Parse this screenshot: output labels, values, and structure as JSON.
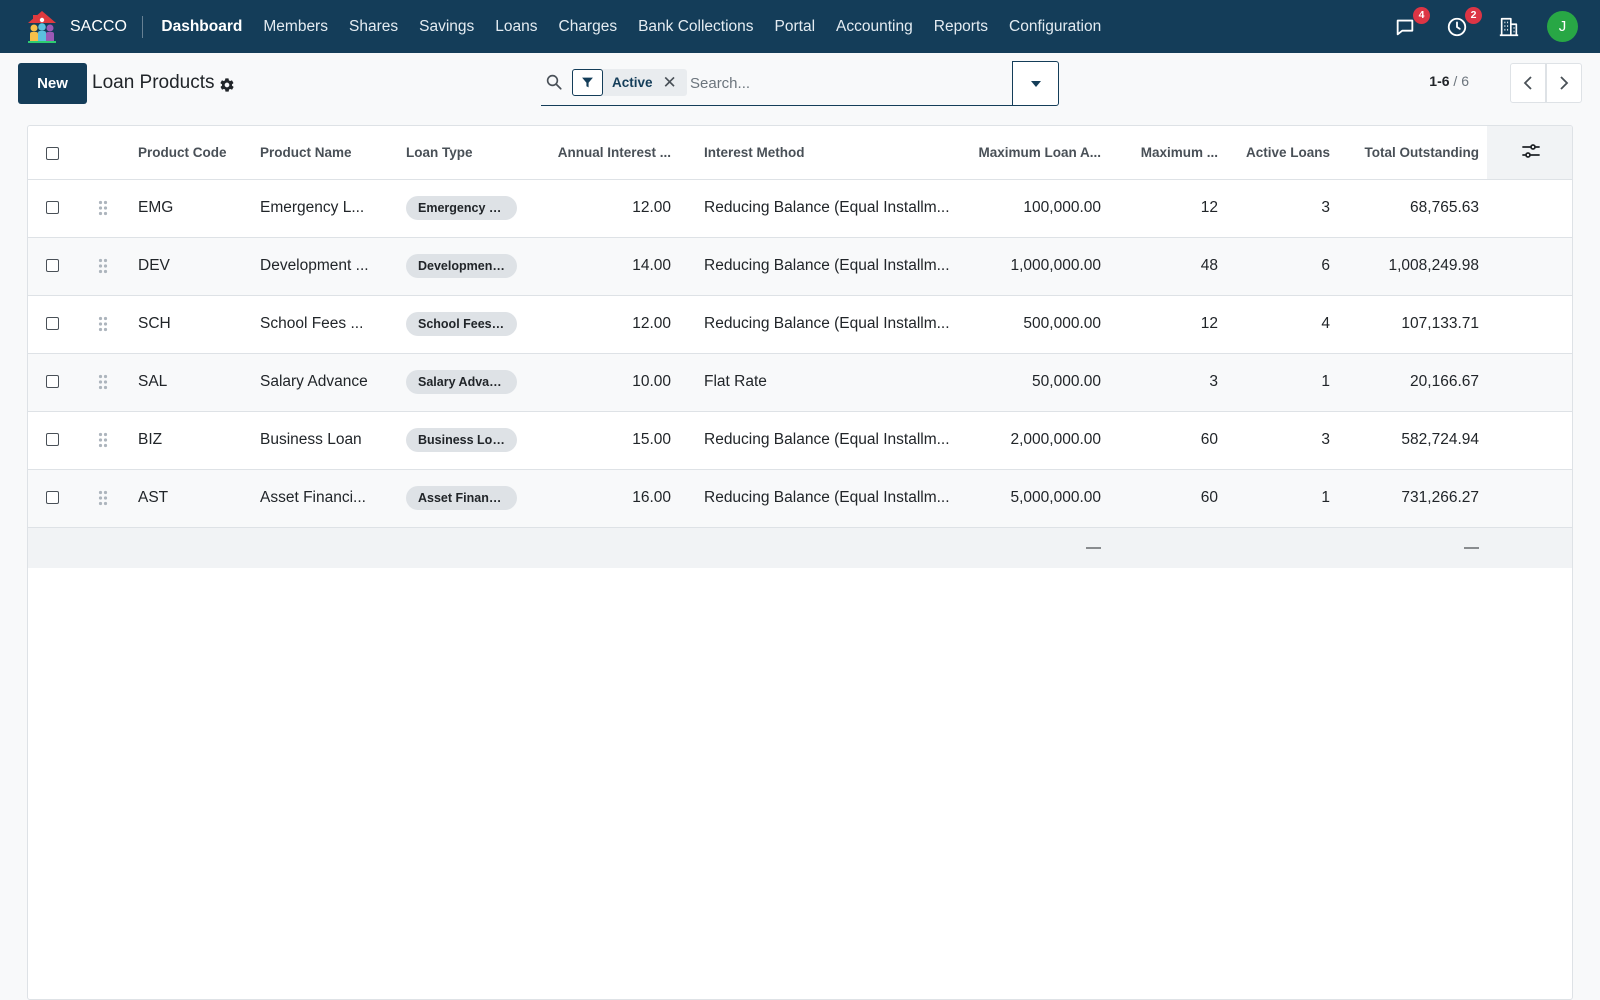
{
  "app": {
    "name": "SACCO",
    "menu": [
      "Dashboard",
      "Members",
      "Shares",
      "Savings",
      "Loans",
      "Charges",
      "Bank Collections",
      "Portal",
      "Accounting",
      "Reports",
      "Configuration"
    ],
    "active_menu": "Dashboard",
    "systray": {
      "messages_count": "4",
      "activities_count": "2",
      "avatar_initial": "J"
    }
  },
  "control_panel": {
    "new_label": "New",
    "title": "Loan Products",
    "search": {
      "facet_label": "Active",
      "placeholder": "Search..."
    },
    "pager": {
      "range": "1-6",
      "separator": " / ",
      "total": "6"
    }
  },
  "list": {
    "columns": [
      "Product Code",
      "Product Name",
      "Loan Type",
      "Annual Interest ...",
      "Interest Method",
      "Maximum Loan A...",
      "Maximum ...",
      "Active Loans",
      "Total Outstanding"
    ],
    "rows": [
      {
        "code": "EMG",
        "name": "Emergency L...",
        "type": "Emergency L...",
        "rate": "12.00",
        "method": "Reducing Balance (Equal Installm...",
        "max_amount": "100,000.00",
        "max_period": "12",
        "active_loans": "3",
        "outstanding": "68,765.63"
      },
      {
        "code": "DEV",
        "name": "Development ...",
        "type": "Development...",
        "rate": "14.00",
        "method": "Reducing Balance (Equal Installm...",
        "max_amount": "1,000,000.00",
        "max_period": "48",
        "active_loans": "6",
        "outstanding": "1,008,249.98"
      },
      {
        "code": "SCH",
        "name": "School Fees ...",
        "type": "School Fees ...",
        "rate": "12.00",
        "method": "Reducing Balance (Equal Installm...",
        "max_amount": "500,000.00",
        "max_period": "12",
        "active_loans": "4",
        "outstanding": "107,133.71"
      },
      {
        "code": "SAL",
        "name": "Salary Advance",
        "type": "Salary Advan...",
        "rate": "10.00",
        "method": "Flat Rate",
        "max_amount": "50,000.00",
        "max_period": "3",
        "active_loans": "1",
        "outstanding": "20,166.67"
      },
      {
        "code": "BIZ",
        "name": "Business Loan",
        "type": "Business Loan",
        "rate": "15.00",
        "method": "Reducing Balance (Equal Installm...",
        "max_amount": "2,000,000.00",
        "max_period": "60",
        "active_loans": "3",
        "outstanding": "582,724.94"
      },
      {
        "code": "AST",
        "name": "Asset Financi...",
        "type": "Asset Financ...",
        "rate": "16.00",
        "method": "Reducing Balance (Equal Installm...",
        "max_amount": "5,000,000.00",
        "max_period": "60",
        "active_loans": "1",
        "outstanding": "731,266.27"
      }
    ],
    "footer": {
      "max_amount_total": "—",
      "outstanding_total": "—"
    }
  },
  "colors": {
    "brand": "#143d59",
    "badge": "#dc3545",
    "avatar": "#28a745"
  },
  "icons": [
    "app-logo-icon",
    "chat-icon",
    "clock-icon",
    "building-icon",
    "gear-icon",
    "search-icon",
    "filter-icon",
    "close-icon",
    "caret-down-icon",
    "chevron-left-icon",
    "chevron-right-icon",
    "drag-handle-icon",
    "column-settings-icon"
  ]
}
